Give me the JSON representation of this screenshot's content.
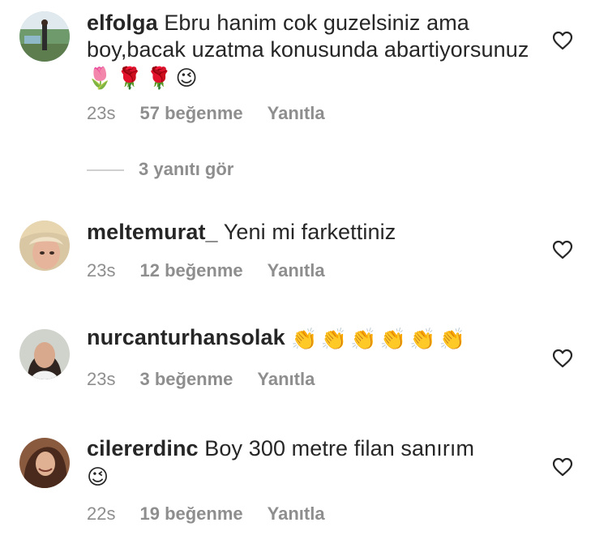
{
  "comments": [
    {
      "username": "elfolga",
      "text": "Ebru hanim cok guzelsiniz ama boy,bacak  uzatma konusunda abartiyorsunuz",
      "emojis": [
        "🌷",
        "🌹",
        "🌹",
        "😉"
      ],
      "time": "23s",
      "likes": "57 beğenme",
      "reply": "Yanıtla"
    },
    {
      "username": "meltemurat_",
      "text": "Yeni mi farkettiniz",
      "time": "23s",
      "likes": "12 beğenme",
      "reply": "Yanıtla"
    },
    {
      "username": "nurcanturhansolak",
      "text": "",
      "emojis": [
        "👏",
        "👏",
        "👏",
        "👏",
        "👏",
        "👏"
      ],
      "time": "23s",
      "likes": "3 beğenme",
      "reply": "Yanıtla"
    },
    {
      "username": "cilererdinc",
      "text": "Boy 300 metre filan sanırım",
      "emojis": [
        "😉"
      ],
      "time": "22s",
      "likes": "19 beğenme",
      "reply": "Yanıtla"
    }
  ],
  "view_replies": "3 yanıtı gör",
  "icons": {
    "like": "heart-outline-icon"
  },
  "colors": {
    "text": "#262626",
    "meta": "#8e8e8e",
    "background": "#ffffff"
  }
}
